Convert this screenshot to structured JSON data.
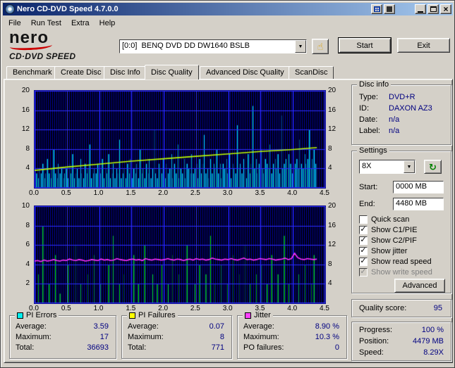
{
  "window": {
    "title": "Nero CD-DVD Speed 4.7.0.0"
  },
  "icons": {
    "dropdown_glyph": "▼",
    "hand_glyph": "☝",
    "refresh_glyph": "↻",
    "check_glyph": "✓"
  },
  "menu": {
    "items": [
      "File",
      "Run Test",
      "Extra",
      "Help"
    ]
  },
  "logo": {
    "brand": "nero",
    "product": "CD·DVD SPEED"
  },
  "toolbar": {
    "drive": "[0:0]  BENQ DVD DD DW1640 BSLB",
    "start_label": "Start",
    "exit_label": "Exit"
  },
  "tabs": [
    {
      "label": "Benchmark",
      "selected": false
    },
    {
      "label": "Create Disc",
      "selected": false
    },
    {
      "label": "Disc Info",
      "selected": false
    },
    {
      "label": "Disc Quality",
      "selected": true
    },
    {
      "label": "Advanced Disc Quality",
      "selected": false
    },
    {
      "label": "ScanDisc",
      "selected": false
    }
  ],
  "disc_info": {
    "title": "Disc info",
    "rows": [
      {
        "label": "Type:",
        "value": "DVD+R"
      },
      {
        "label": "ID:",
        "value": "DAXON AZ3"
      },
      {
        "label": "Date:",
        "value": "n/a"
      },
      {
        "label": "Label:",
        "value": "n/a"
      }
    ]
  },
  "settings": {
    "title": "Settings",
    "speed_value": "8X",
    "start_label": "Start:",
    "start_value": "0000 MB",
    "end_label": "End:",
    "end_value": "4480 MB",
    "checkboxes": [
      {
        "label": "Quick scan",
        "checked": false,
        "disabled": false
      },
      {
        "label": "Show C1/PIE",
        "checked": true,
        "disabled": false
      },
      {
        "label": "Show C2/PIF",
        "checked": true,
        "disabled": false
      },
      {
        "label": "Show jitter",
        "checked": true,
        "disabled": false
      },
      {
        "label": "Show read speed",
        "checked": true,
        "disabled": false
      },
      {
        "label": "Show write speed",
        "checked": true,
        "disabled": true
      }
    ],
    "advanced_label": "Advanced"
  },
  "quality": {
    "label": "Quality score:",
    "value": "95"
  },
  "progress": {
    "rows": [
      {
        "label": "Progress:",
        "value": "100 %"
      },
      {
        "label": "Position:",
        "value": "4479 MB"
      },
      {
        "label": "Speed:",
        "value": "8.29X"
      }
    ]
  },
  "stats": [
    {
      "title": "PI Errors",
      "swatch": "#00efef",
      "rows": [
        {
          "label": "Average:",
          "value": "3.59"
        },
        {
          "label": "Maximum:",
          "value": "17"
        },
        {
          "label": "Total:",
          "value": "36693"
        }
      ]
    },
    {
      "title": "PI Failures",
      "swatch": "#ffff00",
      "rows": [
        {
          "label": "Average:",
          "value": "0.07"
        },
        {
          "label": "Maximum:",
          "value": "8"
        },
        {
          "label": "Total:",
          "value": "771"
        }
      ]
    },
    {
      "title": "Jitter",
      "swatch": "#ff40ff",
      "rows": [
        {
          "label": "Average:",
          "value": "8.90 %"
        },
        {
          "label": "Maximum:",
          "value": "10.3 %"
        },
        {
          "label": "PO failures:",
          "value": "0"
        }
      ]
    }
  ],
  "chart_data": [
    {
      "name": "pi_errors_chart",
      "type": "bar",
      "x_ticks": [
        "0.0",
        "0.5",
        "1.0",
        "1.5",
        "2.0",
        "2.5",
        "3.0",
        "3.5",
        "4.0",
        "4.5"
      ],
      "x_max": 4.5,
      "x_unit": "GB",
      "data_x_end": 4.37,
      "y_left": {
        "max": 20,
        "ticks": [
          "20",
          "16",
          "12",
          "8",
          "4"
        ]
      },
      "y_right": {
        "max": 20,
        "ticks": [
          "20",
          "16",
          "12",
          "8",
          "4"
        ]
      },
      "bg": "#000008",
      "stripe": "#0000a2",
      "grid": "#2d2dff",
      "bars": {
        "name": "PI Errors",
        "color": "#00efef",
        "values": [
          14,
          3,
          2,
          4,
          3,
          5,
          2,
          3,
          6,
          3,
          2,
          4,
          8,
          3,
          2,
          5,
          3,
          4,
          2,
          3,
          4,
          2,
          5,
          3,
          7,
          2,
          3,
          4,
          2,
          6,
          3,
          2,
          5,
          3,
          4,
          9,
          2,
          3,
          4,
          3,
          5,
          2,
          3,
          6,
          2,
          4,
          3,
          7,
          2,
          3,
          5,
          2,
          4,
          3,
          10,
          2,
          3,
          4,
          2,
          5,
          3,
          6,
          2,
          4,
          3,
          5,
          2,
          8,
          3,
          4,
          2,
          5,
          3,
          6,
          2,
          4,
          12,
          3,
          2,
          5,
          4,
          3,
          6,
          2,
          5,
          3,
          4,
          7,
          2,
          5,
          3,
          9,
          2,
          4,
          3,
          6,
          2,
          5,
          4,
          3,
          7,
          3,
          4,
          5,
          2,
          6,
          3,
          5,
          11,
          3,
          4,
          2,
          6,
          3,
          5,
          4,
          8,
          3,
          5,
          2,
          5,
          4,
          6,
          3,
          7,
          2,
          5,
          4,
          3,
          13,
          4,
          5,
          3,
          6,
          4,
          2,
          7,
          3,
          5,
          17,
          4,
          6,
          3,
          5,
          8,
          4,
          3,
          6,
          5,
          4,
          9,
          3,
          5,
          6,
          4,
          7,
          3,
          15,
          4,
          5,
          6,
          4,
          7,
          5,
          3,
          8,
          5,
          6,
          4,
          10,
          5,
          4,
          7,
          5,
          6,
          12,
          4,
          6,
          8,
          5
        ]
      },
      "line": {
        "name": "Read speed",
        "color": "#c0ff00",
        "x": [
          0,
          0.5,
          1.0,
          1.5,
          2.0,
          2.5,
          3.0,
          3.5,
          4.0,
          4.37
        ],
        "y": [
          3.6,
          4.3,
          4.9,
          5.5,
          6.0,
          6.5,
          7.0,
          7.5,
          7.9,
          8.3
        ]
      }
    },
    {
      "name": "pi_failures_chart",
      "type": "bar",
      "x_ticks": [
        "0.0",
        "0.5",
        "1.0",
        "1.5",
        "2.0",
        "2.5",
        "3.0",
        "3.5",
        "4.0",
        "4.5"
      ],
      "x_max": 4.5,
      "x_unit": "GB",
      "data_x_end": 4.37,
      "y_left": {
        "max": 10,
        "ticks": [
          "10",
          "8",
          "6",
          "4",
          "2"
        ]
      },
      "y_right": {
        "max": 20,
        "ticks": [
          "20",
          "16",
          "12",
          "8",
          "4"
        ]
      },
      "bg": "#000008",
      "stripe": "#0000a2",
      "grid": "#2d2dff",
      "bars": {
        "name": "PI Failures",
        "color": "#00dc00",
        "values": [
          0,
          0,
          3,
          0,
          0,
          8,
          0,
          0,
          0,
          2,
          0,
          0,
          0,
          5,
          0,
          0,
          1,
          0,
          0,
          0,
          0,
          4,
          0,
          0,
          0,
          0,
          6,
          0,
          0,
          2,
          0,
          0,
          0,
          0,
          3,
          0,
          0,
          0,
          5,
          0,
          0,
          0,
          2,
          0,
          0,
          0,
          0,
          4,
          0,
          0,
          7,
          0,
          0,
          0,
          2,
          0,
          0,
          3,
          0,
          0,
          0,
          0,
          0,
          5,
          0,
          0,
          2,
          0,
          0,
          0,
          6,
          0,
          0,
          0,
          0,
          3,
          0,
          0,
          2,
          0,
          0,
          4,
          0,
          0,
          0,
          2,
          0,
          0,
          5,
          0,
          0,
          0,
          3,
          0,
          0,
          0,
          0,
          6,
          0,
          0,
          0,
          0,
          2,
          0,
          0,
          4,
          0,
          0,
          0,
          3,
          0,
          0,
          7,
          0,
          0,
          2,
          0,
          0,
          0,
          4,
          0,
          0,
          0,
          2,
          0,
          0,
          5,
          0,
          0,
          0,
          3,
          0,
          0,
          0,
          6,
          0,
          0,
          2,
          0,
          0,
          0,
          3,
          0,
          0,
          4,
          0,
          0,
          0,
          2,
          0,
          0,
          5,
          0,
          0,
          0,
          3,
          0,
          0,
          0,
          7,
          0,
          0,
          2,
          0,
          0,
          6,
          0,
          0,
          3,
          0,
          0,
          0,
          4,
          0,
          0,
          0,
          2,
          0,
          5,
          0
        ]
      },
      "line": {
        "name": "Jitter",
        "color": "#ff30ff",
        "y": [
          8.7,
          8.8,
          8.6,
          8.9,
          8.7,
          8.8,
          9.0,
          8.8,
          8.7,
          8.9,
          8.8,
          9.1,
          8.9,
          8.8,
          9.0,
          8.9,
          8.7,
          8.8,
          9.0,
          8.9,
          8.8,
          9.1,
          8.9,
          9.0,
          8.8,
          8.9,
          9.2,
          9.0,
          8.9,
          8.8,
          9.0,
          9.1,
          8.9,
          9.0,
          8.8,
          9.2,
          9.0,
          8.9,
          9.1,
          9.0,
          8.9,
          9.0,
          9.2,
          9.0,
          8.9,
          9.1,
          9.0,
          8.8,
          9.0,
          9.1,
          8.9,
          9.2,
          9.0,
          9.1,
          8.9,
          9.0,
          9.3,
          9.1,
          9.0,
          8.9,
          9.1,
          9.0,
          9.2,
          9.0,
          8.9,
          9.1,
          9.3,
          9.0,
          9.1,
          8.9,
          9.0,
          9.2,
          9.1,
          9.0,
          9.2,
          9.1,
          8.9,
          9.0,
          9.1,
          9.3,
          9.0,
          9.2,
          10.3,
          9.4,
          9.1,
          9.0,
          9.2,
          9.1,
          9.0,
          9.1
        ]
      }
    }
  ]
}
